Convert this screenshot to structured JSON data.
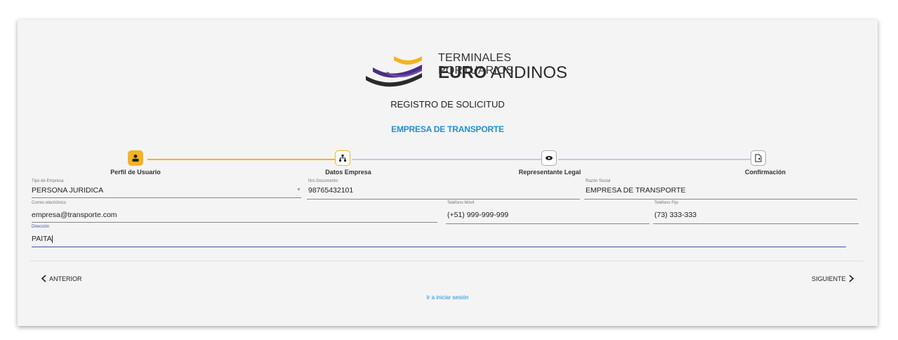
{
  "logo": {
    "line1": "TERMINALES PORTUARIOS",
    "line2_bold": "EURO",
    "line2_rest": "ANDINOS"
  },
  "title": "REGISTRO DE SOLICITUD",
  "subtitle": "EMPRESA DE TRANSPORTE",
  "steps": [
    {
      "label": "Perfil de Usuario",
      "icon": "user-icon"
    },
    {
      "label": "Datos Empresa",
      "icon": "sitemap-icon"
    },
    {
      "label": "Representante Legal",
      "icon": "eye-icon"
    },
    {
      "label": "Confirmación",
      "icon": "file-add-icon"
    }
  ],
  "form": {
    "tipo_empresa": {
      "label": "Tipo de Empresa",
      "value": "PERSONA JURIDICA"
    },
    "nro_documento": {
      "label": "Nro Documento",
      "value": "98765432101"
    },
    "razon_social": {
      "label": "Razón Social",
      "value": "EMPRESA DE TRANSPORTE"
    },
    "correo": {
      "label": "Correo electrónico",
      "value": "empresa@transporte.com"
    },
    "telefono_movil": {
      "label": "Teléfono Móvil",
      "value": "(+51) 999-999-999"
    },
    "telefono_fijo": {
      "label": "Teléfono Fijo",
      "value": "(73) 333-333"
    },
    "direccion": {
      "label": "Dirección",
      "value": "PAITA"
    }
  },
  "nav": {
    "prev": "ANTERIOR",
    "next": "SIGUIENTE"
  },
  "login_link": "Ir a iniciar sesión",
  "colors": {
    "accent_yellow": "#f5b324",
    "link_blue": "#1e90d8",
    "inactive_line": "#c5cae9",
    "active_field": "#3f51b5",
    "logo_purple": "#4b2d83"
  }
}
